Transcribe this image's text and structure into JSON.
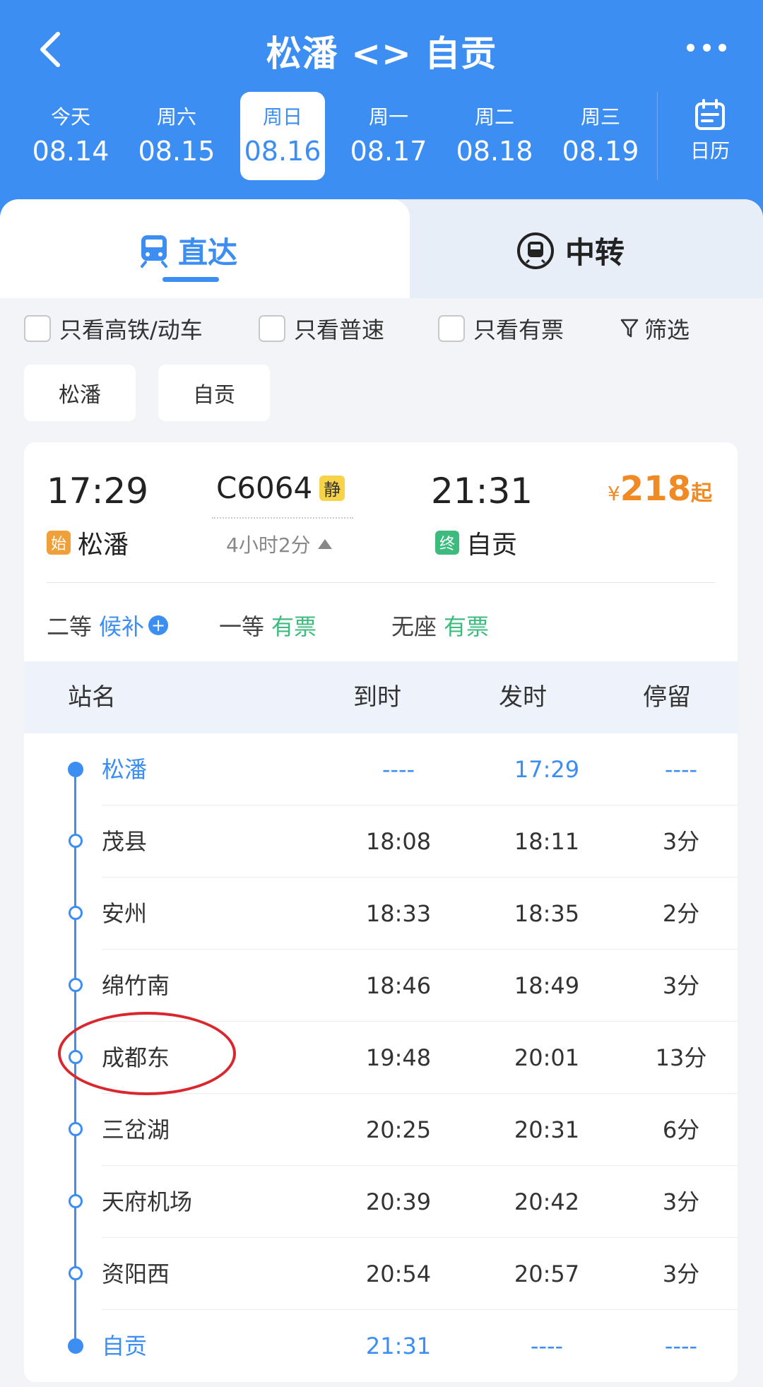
{
  "header": {
    "title": "松潘 <> 自贡",
    "back_icon": "chevron-left-icon",
    "more_icon": "more-dots-icon"
  },
  "dates": [
    {
      "dow": "今天",
      "date": "08.14",
      "active": false
    },
    {
      "dow": "周六",
      "date": "08.15",
      "active": false
    },
    {
      "dow": "周日",
      "date": "08.16",
      "active": true
    },
    {
      "dow": "周一",
      "date": "08.17",
      "active": false
    },
    {
      "dow": "周二",
      "date": "08.18",
      "active": false
    },
    {
      "dow": "周三",
      "date": "08.19",
      "active": false
    }
  ],
  "calendar": {
    "label": "日历",
    "icon": "calendar-icon"
  },
  "tabs": {
    "direct": {
      "label": "直达",
      "icon": "train-icon"
    },
    "transfer": {
      "label": "中转",
      "icon": "transfer-icon"
    }
  },
  "filters": {
    "high_speed": "只看高铁/动车",
    "normal": "只看普速",
    "available": "只看有票",
    "filter": "筛选"
  },
  "station_chips": [
    "松潘",
    "自贡"
  ],
  "train": {
    "dep_time": "17:29",
    "dep_station": "松潘",
    "start_tag": "始",
    "number": "C6064",
    "quiet_tag": "静",
    "duration": "4小时2分",
    "arr_time": "21:31",
    "arr_station": "自贡",
    "end_tag": "终",
    "price_currency": "¥",
    "price": "218",
    "price_suffix": "起",
    "seats": [
      {
        "class": "二等",
        "status": "候补",
        "kind": "wait"
      },
      {
        "class": "一等",
        "status": "有票",
        "kind": "ok"
      },
      {
        "class": "无座",
        "status": "有票",
        "kind": "ok"
      }
    ]
  },
  "table": {
    "headers": {
      "name": "站名",
      "arrive": "到时",
      "depart": "发时",
      "stay": "停留"
    },
    "rows": [
      {
        "name": "松潘",
        "arrive": "----",
        "depart": "17:29",
        "stay": "----",
        "highlight": true
      },
      {
        "name": "茂县",
        "arrive": "18:08",
        "depart": "18:11",
        "stay": "3分",
        "highlight": false
      },
      {
        "name": "安州",
        "arrive": "18:33",
        "depart": "18:35",
        "stay": "2分",
        "highlight": false
      },
      {
        "name": "绵竹南",
        "arrive": "18:46",
        "depart": "18:49",
        "stay": "3分",
        "highlight": false
      },
      {
        "name": "成都东",
        "arrive": "19:48",
        "depart": "20:01",
        "stay": "13分",
        "highlight": false
      },
      {
        "name": "三岔湖",
        "arrive": "20:25",
        "depart": "20:31",
        "stay": "6分",
        "highlight": false
      },
      {
        "name": "天府机场",
        "arrive": "20:39",
        "depart": "20:42",
        "stay": "3分",
        "highlight": false
      },
      {
        "name": "资阳西",
        "arrive": "20:54",
        "depart": "20:57",
        "stay": "3分",
        "highlight": false
      },
      {
        "name": "自贡",
        "arrive": "21:31",
        "depart": "----",
        "stay": "----",
        "highlight": true
      }
    ]
  },
  "colors": {
    "primary": "#3d8ef3",
    "price": "#f08a24",
    "available": "#3dbb7f",
    "annotation": "#d9272e"
  }
}
